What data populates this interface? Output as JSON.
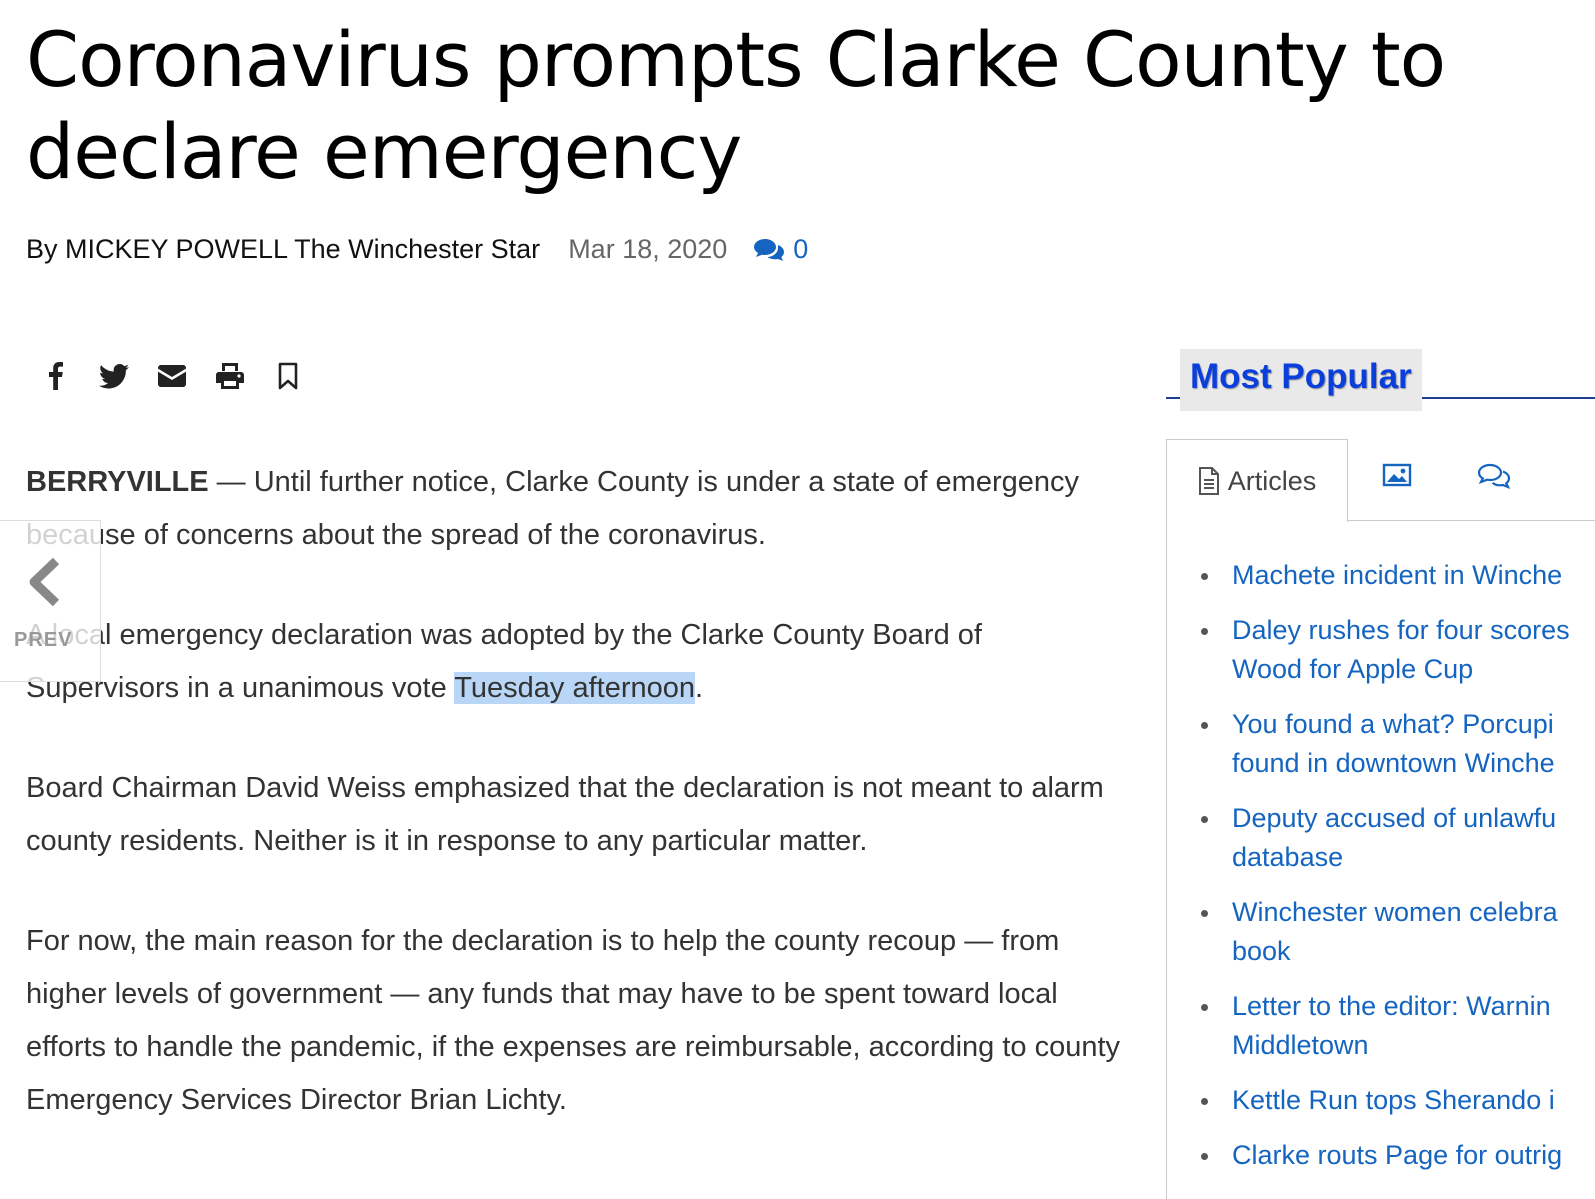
{
  "article": {
    "headline": "Coronavirus prompts Clarke County to declare emergency",
    "byline": "By MICKEY POWELL The Winchester Star",
    "date": "Mar 18, 2020",
    "comment_count": "0",
    "dateline": "BERRYVILLE",
    "p1": " — Until further notice, Clarke County is under a state of emergency because of concerns about the spread of the coronavirus.",
    "p2_before": "A local emergency declaration was adopted by the Clarke County Board of Supervisors in a unanimous vote ",
    "p2_highlight": "Tuesday afternoon",
    "p2_after": ".",
    "p3": "Board Chairman David Weiss emphasized that the declaration is not meant to alarm county residents. Neither is it in response to any particular matter.",
    "p4": "For now, the main reason for the declaration is to help the county recoup — from higher levels of government — any funds that may have to be spent toward local efforts to handle the pandemic, if the expenses are reimbursable, according to county Emergency Services Director Brian Lichty."
  },
  "share_icons": [
    "facebook-icon",
    "twitter-icon",
    "email-icon",
    "print-icon",
    "bookmark-icon"
  ],
  "prev_nav": {
    "label": "PREV"
  },
  "sidebar": {
    "title": "Most Popular",
    "tabs": {
      "articles_label": "Articles"
    },
    "items": [
      "Machete incident in Winche",
      "Daley rushes for four scores Wood for Apple Cup",
      "You found a what? Porcupi found in downtown Winche",
      "Deputy accused of unlawfu database",
      "Winchester women celebra book",
      "Letter to the editor: Warnin Middletown",
      "Kettle Run tops Sherando i",
      "Clarke routs Page for outrig"
    ]
  },
  "colors": {
    "link": "#1565c0",
    "popular_title": "#0b3fdc",
    "highlight": "#b9d6f7"
  }
}
